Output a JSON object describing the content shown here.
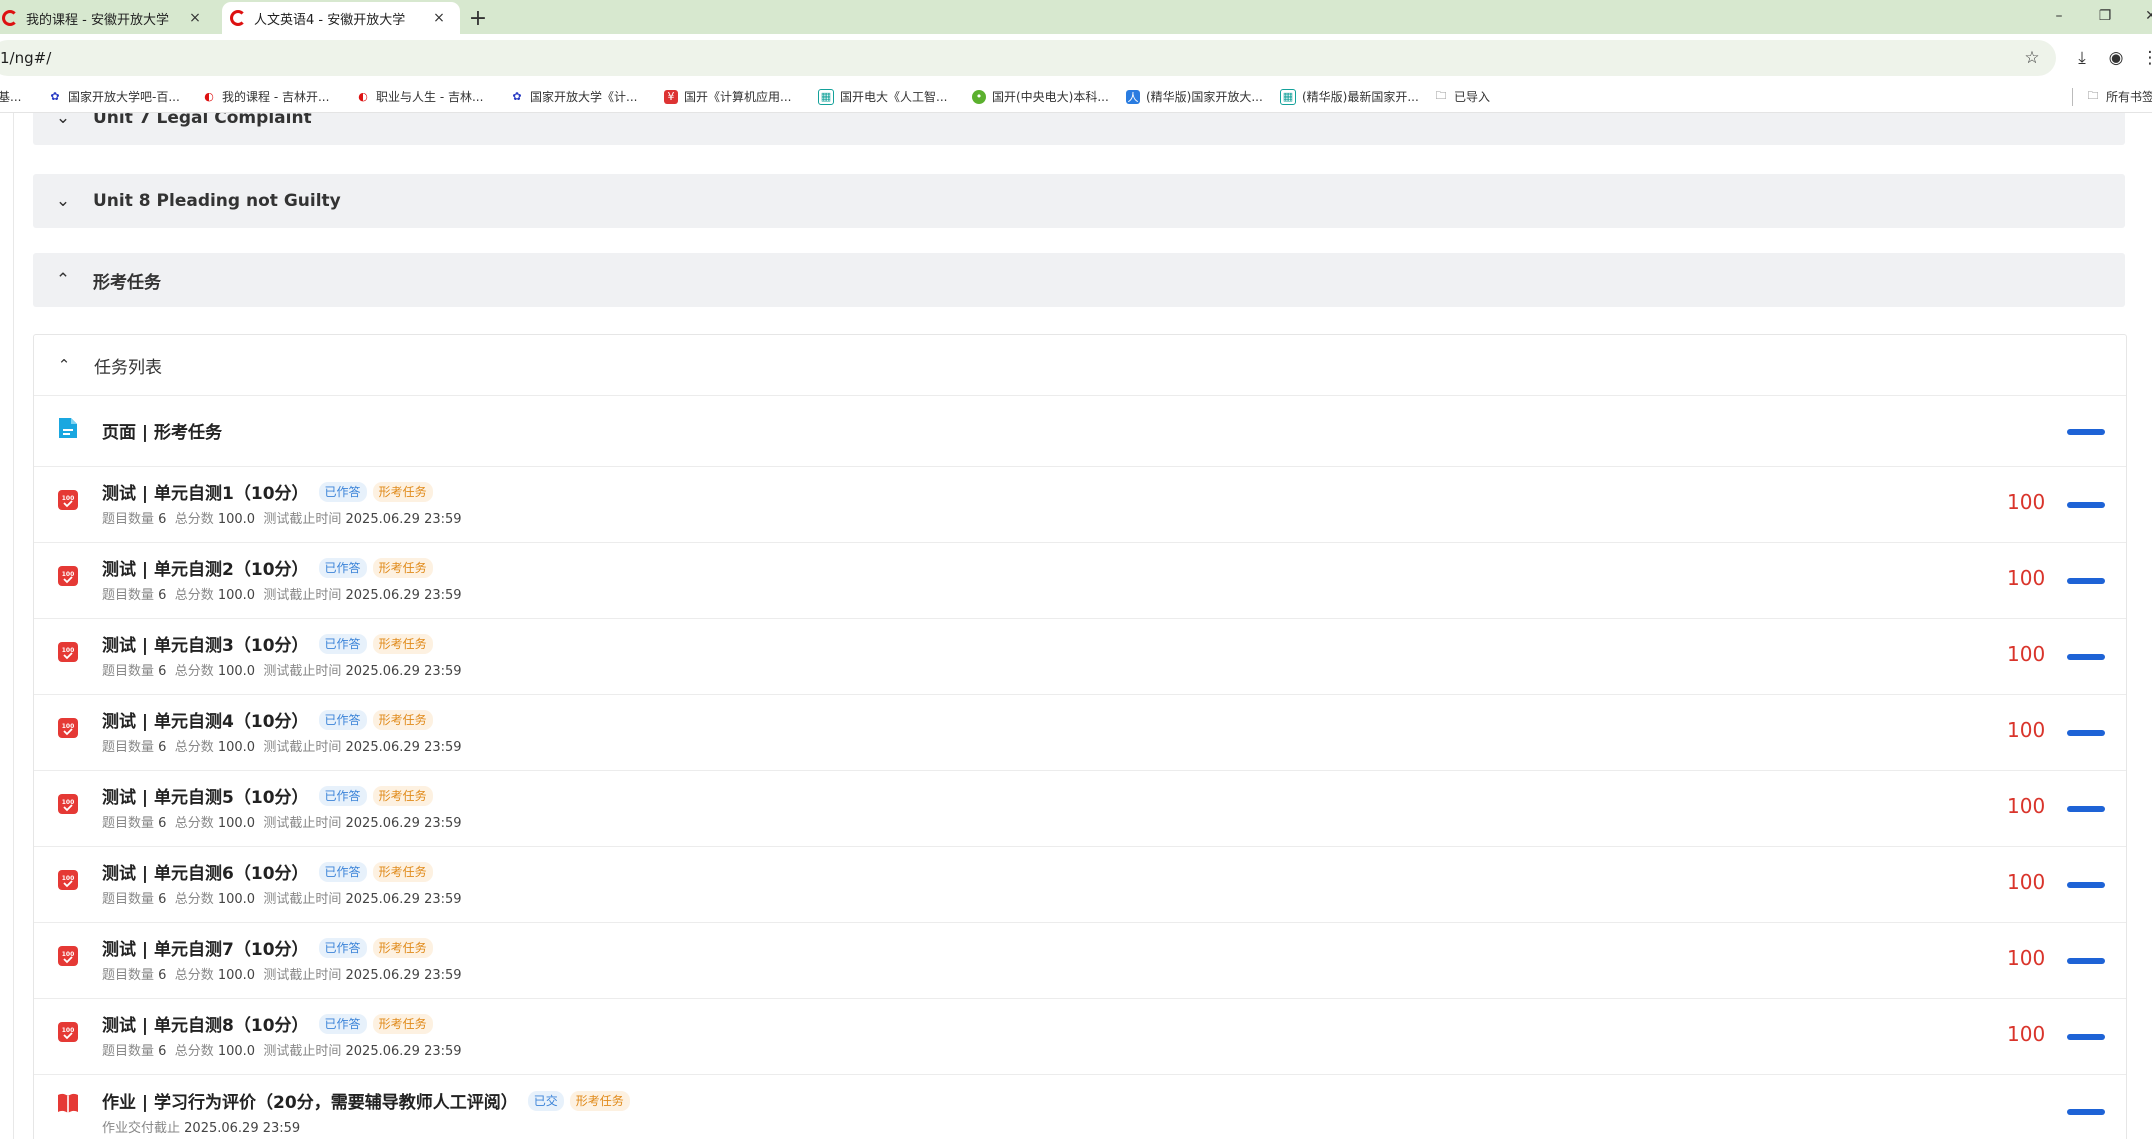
{
  "browser": {
    "tabs": [
      {
        "title": "我的课程 - 安徽开放大学",
        "close": "×"
      },
      {
        "title": "人文英语4 - 安徽开放大学",
        "close": "×"
      }
    ],
    "new_tab": "+",
    "window_controls": [
      "–",
      "❐",
      "✕"
    ],
    "url": "1/ng#/",
    "bookmarks": [
      {
        "label": "基...",
        "icon": "page-icon"
      },
      {
        "label": "国家开放大学吧-百...",
        "icon": "paw-icon"
      },
      {
        "label": "我的课程 - 吉林开...",
        "icon": "c-logo-icon"
      },
      {
        "label": "职业与人生 - 吉林...",
        "icon": "c-logo-icon"
      },
      {
        "label": "国家开放大学《计...",
        "icon": "paw-icon"
      },
      {
        "label": "国开《计算机应用...",
        "icon": "doc-icon"
      },
      {
        "label": "国开电大《人工智...",
        "icon": "grid-icon"
      },
      {
        "label": "国开(中央电大)本科...",
        "icon": "circle-icon"
      },
      {
        "label": "(精华版)国家开放大...",
        "icon": "person-icon"
      },
      {
        "label": "(精华版)最新国家开...",
        "icon": "grid-icon"
      },
      {
        "label": "已导入",
        "icon": "folder-icon"
      },
      {
        "label": "所有书签",
        "icon": "folder-icon"
      }
    ]
  },
  "units": [
    {
      "label": "Unit 7 Legal Complaint",
      "state": "collapsed"
    },
    {
      "label": "Unit 8 Pleading not Guilty",
      "state": "collapsed"
    },
    {
      "label": "形考任务",
      "state": "expanded"
    }
  ],
  "task_list": {
    "header": "任务列表",
    "page_item": {
      "title": "页面 | 形考任务",
      "progress": 1.0
    },
    "quiz_labels": {
      "count": "题目数量",
      "total": "总分数",
      "deadline": "测试截止时间"
    },
    "quizzes": [
      {
        "title": "测试 | 单元自测1（10分）",
        "status": "已作答",
        "category": "形考任务",
        "count": "6",
        "total": "100.0",
        "deadline": "2025.06.29 23:59",
        "score": "100",
        "progress": 1.0
      },
      {
        "title": "测试 | 单元自测2（10分）",
        "status": "已作答",
        "category": "形考任务",
        "count": "6",
        "total": "100.0",
        "deadline": "2025.06.29 23:59",
        "score": "100",
        "progress": 1.0
      },
      {
        "title": "测试 | 单元自测3（10分）",
        "status": "已作答",
        "category": "形考任务",
        "count": "6",
        "total": "100.0",
        "deadline": "2025.06.29 23:59",
        "score": "100",
        "progress": 1.0
      },
      {
        "title": "测试 | 单元自测4（10分）",
        "status": "已作答",
        "category": "形考任务",
        "count": "6",
        "total": "100.0",
        "deadline": "2025.06.29 23:59",
        "score": "100",
        "progress": 1.0
      },
      {
        "title": "测试 | 单元自测5（10分）",
        "status": "已作答",
        "category": "形考任务",
        "count": "6",
        "total": "100.0",
        "deadline": "2025.06.29 23:59",
        "score": "100",
        "progress": 1.0
      },
      {
        "title": "测试 | 单元自测6（10分）",
        "status": "已作答",
        "category": "形考任务",
        "count": "6",
        "total": "100.0",
        "deadline": "2025.06.29 23:59",
        "score": "100",
        "progress": 1.0
      },
      {
        "title": "测试 | 单元自测7（10分）",
        "status": "已作答",
        "category": "形考任务",
        "count": "6",
        "total": "100.0",
        "deadline": "2025.06.29 23:59",
        "score": "100",
        "progress": 1.0
      },
      {
        "title": "测试 | 单元自测8（10分）",
        "status": "已作答",
        "category": "形考任务",
        "count": "6",
        "total": "100.0",
        "deadline": "2025.06.29 23:59",
        "score": "100",
        "progress": 1.0
      }
    ],
    "homework": {
      "title": "作业 | 学习行为评价（20分，需要辅导教师人工评阅）",
      "status": "已交",
      "category": "形考任务",
      "deadline_label": "作业交付截止",
      "deadline": "2025.06.29 23:59",
      "progress": 1.0
    }
  },
  "colors": {
    "accent": "#1e63d6",
    "score": "#d9342b",
    "tab_bar": "#d7e8cf",
    "quiz_icon": "#e53935"
  }
}
